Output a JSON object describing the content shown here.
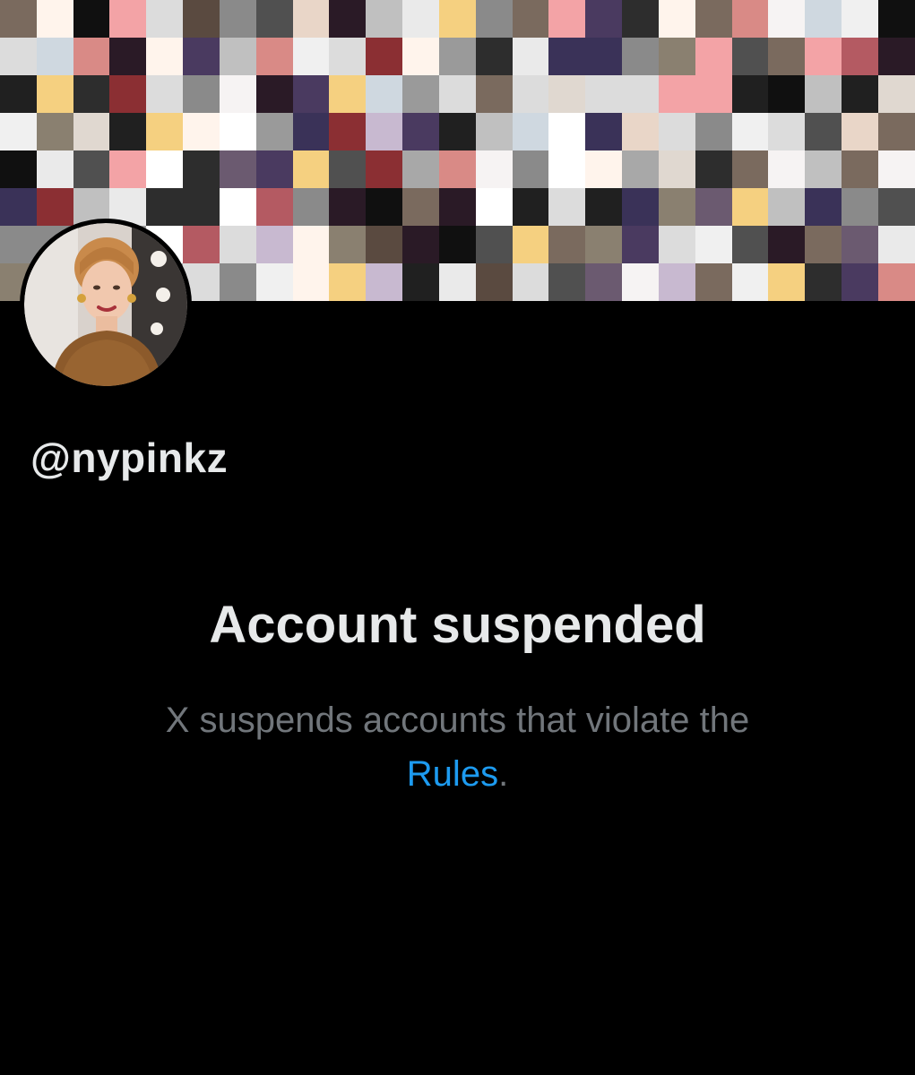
{
  "profile": {
    "handle": "@nypinkz",
    "banner_description": "pixelated",
    "avatar_icon": "profile-photo"
  },
  "suspension": {
    "title": "Account suspended",
    "message": "X suspends accounts that violate the",
    "link_label": "Rules",
    "trailing": "."
  },
  "colors": {
    "background": "#000000",
    "primary_text": "#e7e9ea",
    "secondary_text": "#71767b",
    "link": "#1d9bf0"
  }
}
